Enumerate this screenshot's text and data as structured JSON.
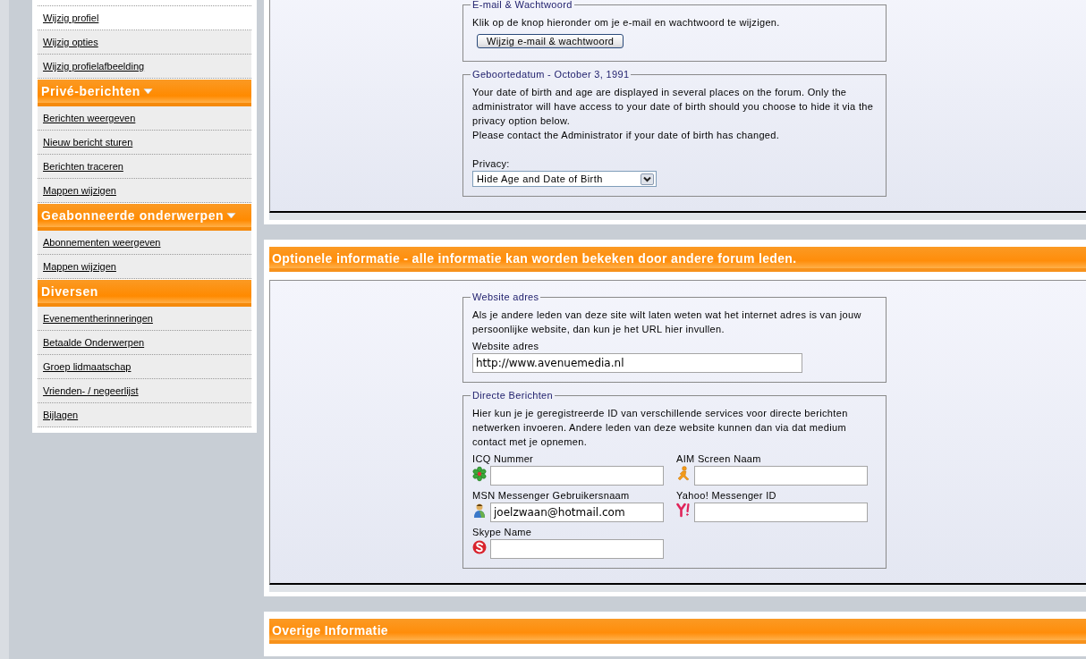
{
  "sidebar": {
    "groups": [
      {
        "items": [
          {
            "label": "Wijzig profiel",
            "selected": true
          },
          {
            "label": "Wijzig opties",
            "selected": false
          },
          {
            "label": "Wijzig profielafbeelding",
            "selected": false
          }
        ]
      },
      {
        "title": "Privé-berichten",
        "dropdown": true,
        "items": [
          {
            "label": "Berichten weergeven",
            "selected": false
          },
          {
            "label": "Nieuw bericht sturen",
            "selected": false
          },
          {
            "label": "Berichten traceren",
            "selected": false
          },
          {
            "label": "Mappen wijzigen",
            "selected": false
          }
        ]
      },
      {
        "title": "Geabonneerde onderwerpen",
        "dropdown": true,
        "items": [
          {
            "label": "Abonnementen weergeven",
            "selected": false
          },
          {
            "label": "Mappen wijzigen",
            "selected": false
          }
        ]
      },
      {
        "title": "Diversen",
        "dropdown": false,
        "items": [
          {
            "label": "Evenementherinneringen",
            "selected": false
          },
          {
            "label": "Betaalde Onderwerpen",
            "selected": false
          },
          {
            "label": "Groep lidmaatschap",
            "selected": false
          },
          {
            "label": "Vrienden- / negeerlijst",
            "selected": false
          },
          {
            "label": "Bijlagen",
            "selected": false
          }
        ]
      }
    ]
  },
  "panels": [
    {
      "fieldsets": [
        {
          "legend": "E-mail & Wachtwoord",
          "blocks": [
            {
              "kind": "paragraph",
              "text": "Klik op de knop hieronder om je e-mail en wachtwoord te wijzigen."
            },
            {
              "kind": "button",
              "label": "Wijzig e-mail & wachtwoord"
            }
          ]
        },
        {
          "legend": "Geboortedatum - October 3, 1991",
          "blocks": [
            {
              "kind": "paragraph",
              "text": "Your date of birth and age are displayed in several places on the forum. Only the administrator will have access to your date of birth should you choose to hide it via the privacy option below."
            },
            {
              "kind": "paragraph",
              "text": "Please contact the Administrator if your date of birth has changed."
            },
            {
              "kind": "select",
              "label": "Privacy:",
              "value": "Hide Age and Date of Birth"
            }
          ]
        }
      ]
    },
    {
      "title": "Optionele informatie - alle informatie kan worden bekeken door andere forum leden.",
      "fieldsets": [
        {
          "legend": "Website adres",
          "blocks": [
            {
              "kind": "paragraph",
              "text": "Als je andere leden van deze site wilt laten weten wat het internet adres is van jouw persoonlijke website, dan kun je het URL hier invullen."
            },
            {
              "kind": "input",
              "label": "Website adres",
              "value": "http://www.avenuemedia.nl"
            }
          ]
        },
        {
          "legend": "Directe Berichten",
          "blocks": [
            {
              "kind": "paragraph",
              "text": "Hier kun je je geregistreerde ID van verschillende services voor directe berichten netwerken invoeren. Andere leden van deze website kunnen dan via dat medium contact met je opnemen."
            },
            {
              "kind": "messengers",
              "fields": [
                {
                  "kind": "icq",
                  "label": "ICQ Nummer"
                },
                {
                  "kind": "aim",
                  "label": "AIM Screen Naam"
                },
                {
                  "kind": "msn",
                  "label": "MSN Messenger Gebruikersnaam",
                  "value": "joelzwaan@hotmail.com"
                },
                {
                  "kind": "yahoo",
                  "label": "Yahoo! Messenger ID"
                },
                {
                  "kind": "skype",
                  "label": "Skype Name"
                }
              ]
            }
          ]
        }
      ]
    },
    {
      "title": "Overige Informatie"
    }
  ]
}
